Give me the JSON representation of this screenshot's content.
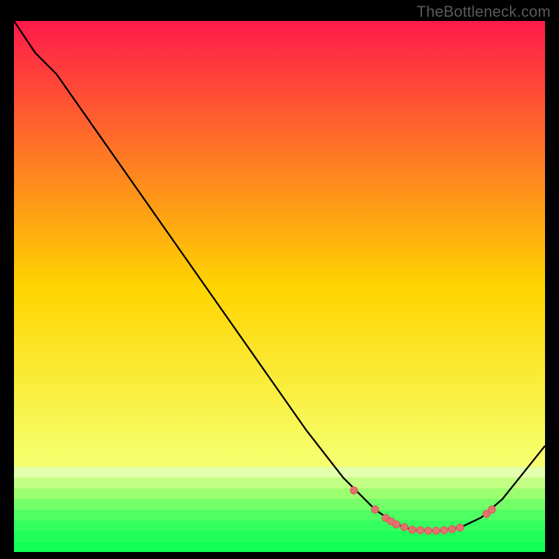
{
  "watermark": "TheBottleneck.com",
  "colors": {
    "bg": "#000000",
    "curve": "#000000",
    "marker_fill": "#e4716d",
    "marker_stroke": "#d65b57",
    "gradient_top": "#ff1a4a",
    "gradient_mid": "#ffd400",
    "gradient_green1": "#c8ff66",
    "gradient_green2": "#5fff7a",
    "gradient_green3": "#2fff66",
    "gradient_bottom": "#0fff55"
  },
  "chart_data": {
    "type": "line",
    "title": "",
    "xlabel": "",
    "ylabel": "",
    "xlim": [
      0,
      100
    ],
    "ylim": [
      0,
      100
    ],
    "grid": false,
    "legend": false,
    "curve": [
      {
        "x": 0,
        "y": 100
      },
      {
        "x": 4,
        "y": 94
      },
      {
        "x": 8,
        "y": 90
      },
      {
        "x": 55,
        "y": 23
      },
      {
        "x": 62,
        "y": 14
      },
      {
        "x": 68,
        "y": 8
      },
      {
        "x": 72,
        "y": 5.2
      },
      {
        "x": 75,
        "y": 4.2
      },
      {
        "x": 80,
        "y": 4.0
      },
      {
        "x": 84,
        "y": 4.6
      },
      {
        "x": 88,
        "y": 6.5
      },
      {
        "x": 92,
        "y": 10
      },
      {
        "x": 100,
        "y": 20
      }
    ],
    "markers": [
      {
        "x": 64,
        "y": 11.6
      },
      {
        "x": 68,
        "y": 8.0
      },
      {
        "x": 70,
        "y": 6.4
      },
      {
        "x": 71,
        "y": 5.8
      },
      {
        "x": 72,
        "y": 5.2
      },
      {
        "x": 73.5,
        "y": 4.7
      },
      {
        "x": 75,
        "y": 4.2
      },
      {
        "x": 76.5,
        "y": 4.1
      },
      {
        "x": 78,
        "y": 4.0
      },
      {
        "x": 79.5,
        "y": 4.0
      },
      {
        "x": 81,
        "y": 4.1
      },
      {
        "x": 82.5,
        "y": 4.3
      },
      {
        "x": 84,
        "y": 4.6
      },
      {
        "x": 89,
        "y": 7.2
      },
      {
        "x": 90,
        "y": 8.0
      }
    ],
    "green_bands": [
      {
        "y": 14,
        "h": 2.0,
        "c": "#e4ffae"
      },
      {
        "y": 12,
        "h": 2.0,
        "c": "#c3ff85"
      },
      {
        "y": 10,
        "h": 2.0,
        "c": "#9cff70"
      },
      {
        "y": 8,
        "h": 2.0,
        "c": "#74ff69"
      },
      {
        "y": 6,
        "h": 2.0,
        "c": "#4fff63"
      },
      {
        "y": 4,
        "h": 2.0,
        "c": "#35ff5e"
      },
      {
        "y": 2,
        "h": 2.0,
        "c": "#20ff59"
      },
      {
        "y": 0,
        "h": 2.0,
        "c": "#12ff55"
      }
    ]
  }
}
